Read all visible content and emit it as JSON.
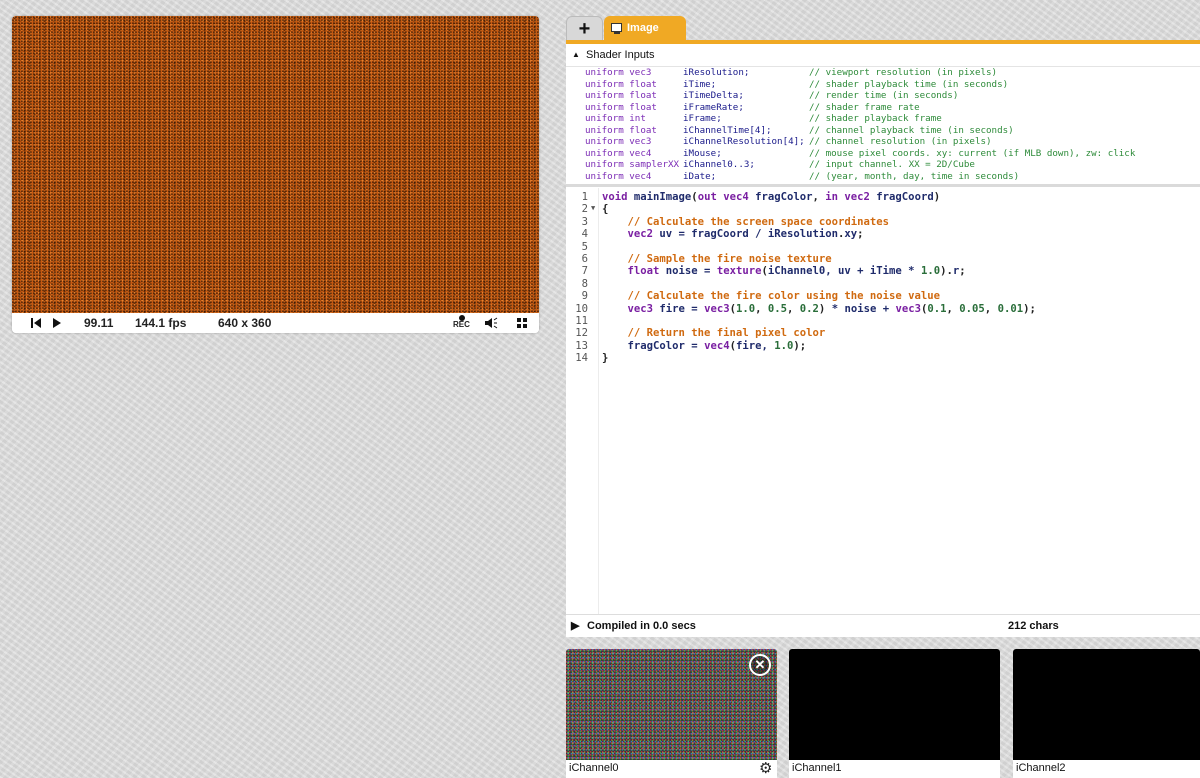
{
  "player": {
    "time": "99.11",
    "fps": "144.1 fps",
    "resolution": "640 x 360",
    "rec_label": "REC",
    "icons": [
      "rewind-icon",
      "play-icon",
      "record-icon",
      "volume-icon",
      "fullscreen-icon"
    ]
  },
  "tabs": [
    {
      "label": "+",
      "icon": "plus-icon"
    },
    {
      "label": "Image",
      "icon": "monitor-icon",
      "active": true
    }
  ],
  "shader_inputs": {
    "title": "Shader Inputs",
    "rows": [
      {
        "kw": "uniform vec3",
        "name": "iResolution;",
        "comment": "// viewport resolution (in pixels)"
      },
      {
        "kw": "uniform float",
        "name": "iTime;",
        "comment": "// shader playback time (in seconds)"
      },
      {
        "kw": "uniform float",
        "name": "iTimeDelta;",
        "comment": "// render time (in seconds)"
      },
      {
        "kw": "uniform float",
        "name": "iFrameRate;",
        "comment": "// shader frame rate"
      },
      {
        "kw": "uniform int",
        "name": "iFrame;",
        "comment": "// shader playback frame"
      },
      {
        "kw": "uniform float",
        "name": "iChannelTime[4];",
        "comment": "// channel playback time (in seconds)"
      },
      {
        "kw": "uniform vec3",
        "name": "iChannelResolution[4];",
        "comment": "// channel resolution (in pixels)"
      },
      {
        "kw": "uniform vec4",
        "name": "iMouse;",
        "comment": "// mouse pixel coords. xy: current (if MLB down), zw: click"
      },
      {
        "kw": "uniform samplerXX",
        "name": "iChannel0..3;",
        "comment": "// input channel. XX = 2D/Cube"
      },
      {
        "kw": "uniform vec4",
        "name": "iDate;",
        "comment": "// (year, month, day, time in seconds)"
      }
    ]
  },
  "code_lines": [
    [
      [
        "kw",
        "void "
      ],
      [
        "fn",
        "mainImage"
      ],
      [
        "id",
        "("
      ],
      [
        "kw",
        "out vec4 "
      ],
      [
        "fn",
        "fragColor"
      ],
      [
        "id",
        ", "
      ],
      [
        "kw",
        "in vec2 "
      ],
      [
        "fn",
        "fragCoord"
      ],
      [
        "id",
        ")"
      ]
    ],
    [
      [
        "id",
        "{"
      ]
    ],
    [
      [
        "cm",
        "    // Calculate the screen space coordinates"
      ]
    ],
    [
      [
        "kw",
        "    vec2 "
      ],
      [
        "fn",
        "uv = fragCoord / iResolution"
      ],
      [
        "id",
        "."
      ],
      [
        "fn",
        "xy"
      ],
      [
        "id",
        ";"
      ]
    ],
    [],
    [
      [
        "cm",
        "    // Sample the fire noise texture"
      ]
    ],
    [
      [
        "kw",
        "    float "
      ],
      [
        "fn",
        "noise = "
      ],
      [
        "kw",
        "texture"
      ],
      [
        "id",
        "("
      ],
      [
        "fn",
        "iChannel0, uv + iTime * "
      ],
      [
        "num",
        "1.0"
      ],
      [
        "id",
        ")."
      ],
      [
        "fn",
        "r"
      ],
      [
        "id",
        ";"
      ]
    ],
    [],
    [
      [
        "cm",
        "    // Calculate the fire color using the noise value"
      ]
    ],
    [
      [
        "kw",
        "    vec3 "
      ],
      [
        "fn",
        "fire = "
      ],
      [
        "kw",
        "vec3"
      ],
      [
        "id",
        "("
      ],
      [
        "num",
        "1.0"
      ],
      [
        "id",
        ", "
      ],
      [
        "num",
        "0.5"
      ],
      [
        "id",
        ", "
      ],
      [
        "num",
        "0.2"
      ],
      [
        "id",
        ") "
      ],
      [
        "fn",
        "* noise + "
      ],
      [
        "kw",
        "vec3"
      ],
      [
        "id",
        "("
      ],
      [
        "num",
        "0.1"
      ],
      [
        "id",
        ", "
      ],
      [
        "num",
        "0.05"
      ],
      [
        "id",
        ", "
      ],
      [
        "num",
        "0.01"
      ],
      [
        "id",
        ");"
      ]
    ],
    [],
    [
      [
        "cm",
        "    // Return the final pixel color"
      ]
    ],
    [
      [
        "fn",
        "    fragColor = "
      ],
      [
        "kw",
        "vec4"
      ],
      [
        "id",
        "("
      ],
      [
        "fn",
        "fire, "
      ],
      [
        "num",
        "1.0"
      ],
      [
        "id",
        ");"
      ]
    ],
    [
      [
        "id",
        "}"
      ]
    ]
  ],
  "status": {
    "compiled": "Compiled in 0.0 secs",
    "chars": "212 chars"
  },
  "channels": [
    {
      "name": "iChannel0"
    },
    {
      "name": "iChannel1"
    },
    {
      "name": "iChannel2"
    }
  ],
  "colors": {
    "accent": "#f0a924",
    "preview_fire": "#c55a12",
    "keyword": "#7a1fa2",
    "comment": "#d06a10",
    "number": "#2a6e3a"
  }
}
